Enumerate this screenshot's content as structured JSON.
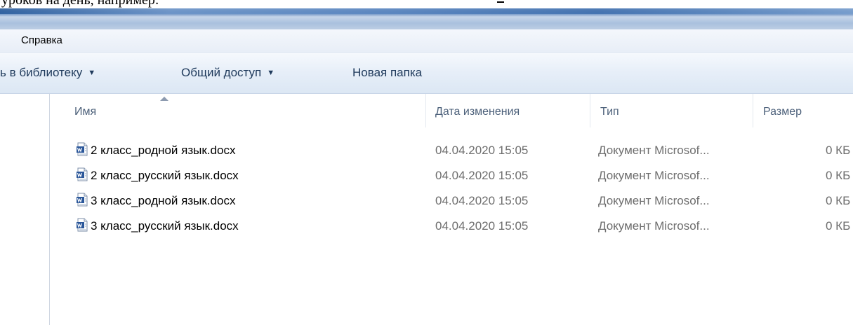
{
  "document_fragment": {
    "text": "уроков на день, например:"
  },
  "menubar": {
    "items": [
      "Справка"
    ]
  },
  "toolbar": {
    "library_label": "ь в библиотеку",
    "share_label": "Общий доступ",
    "new_folder_label": "Новая папка",
    "caret_icon": "chevron-down-icon"
  },
  "columns": {
    "name": "Имя",
    "date": "Дата изменения",
    "type": "Тип",
    "size": "Размер",
    "sort_indicator": "sort-up-icon"
  },
  "files": [
    {
      "name": "2 класс_родной язык.docx",
      "date": "04.04.2020 15:05",
      "type": "Документ Microsof...",
      "size": "0 КБ",
      "icon": "word-document-icon"
    },
    {
      "name": "2 класс_русский язык.docx",
      "date": "04.04.2020 15:05",
      "type": "Документ Microsof...",
      "size": "0 КБ",
      "icon": "word-document-icon"
    },
    {
      "name": "3 класс_родной язык.docx",
      "date": "04.04.2020 15:05",
      "type": "Документ Microsof...",
      "size": "0 КБ",
      "icon": "word-document-icon"
    },
    {
      "name": "3 класс_русский язык.docx",
      "date": "04.04.2020 15:05",
      "type": "Документ Microsof...",
      "size": "0 КБ",
      "icon": "word-document-icon"
    }
  ],
  "colors": {
    "toolbar_text": "#1e395b",
    "header_text": "#4c607a",
    "secondary_text": "#6d6d6d",
    "word_icon_blue": "#2b579a"
  }
}
